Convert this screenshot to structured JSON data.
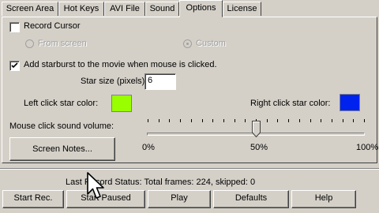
{
  "tabs": [
    "Screen Area",
    "Hot Keys",
    "AVI File",
    "Sound",
    "Options",
    "License"
  ],
  "options": {
    "record_cursor_label": "Record Cursor",
    "radio_from_screen": "From screen",
    "radio_custom": "Custom",
    "starburst_label": "Add starburst to the movie when mouse is clicked.",
    "star_size_label": "Star size (pixels)",
    "star_size_value": "6",
    "left_star_color_label": "Left click star color:",
    "left_star_color": "#99ff00",
    "right_star_color_label": "Right click star color:",
    "right_star_color": "#0022ee",
    "sound_volume_label": "Mouse click sound volume:",
    "volume_level": 0.5,
    "volume_min_label": "0%",
    "volume_mid_label": "50%",
    "volume_max_label": "100%",
    "screen_notes_button": "Screen Notes..."
  },
  "status": {
    "text": "Last Record Status: Total frames: 224, skipped: 0"
  },
  "buttons": {
    "start_rec": "Start Rec.",
    "start_paused": "Start Paused",
    "play": "Play",
    "defaults": "Defaults",
    "help": "Help"
  }
}
